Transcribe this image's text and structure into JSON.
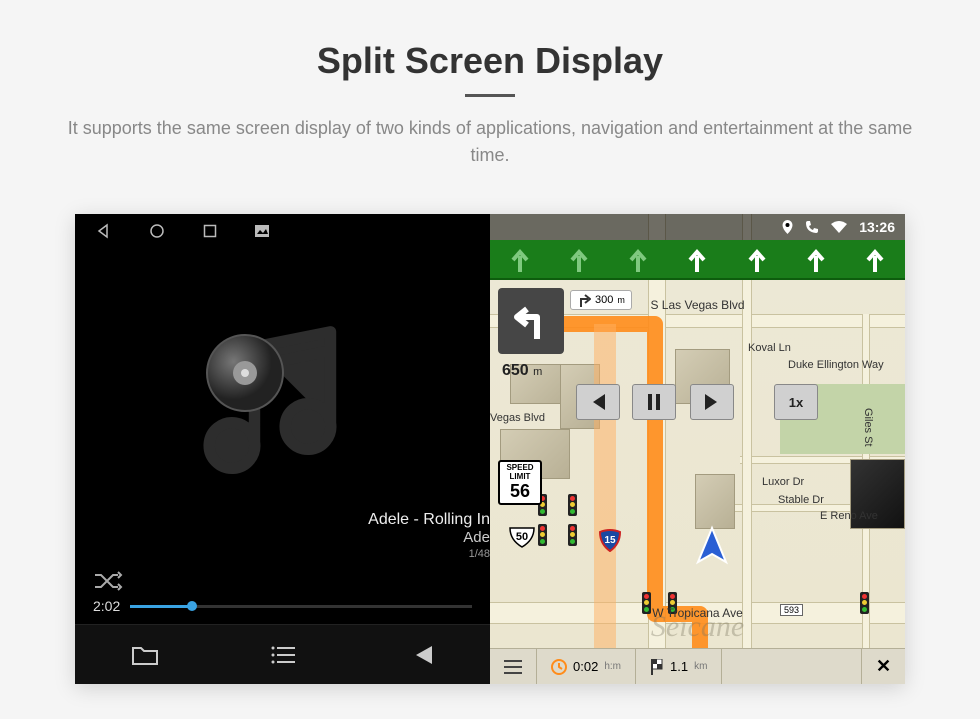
{
  "header": {
    "title": "Split Screen Display",
    "description": "It supports the same screen display of two kinds of applications, navigation and entertainment at the same time."
  },
  "status": {
    "time": "13:26"
  },
  "player": {
    "track_line1": "Adele - Rolling In",
    "track_line2": "Ade",
    "track_count": "1/48",
    "elapsed": "2:02"
  },
  "nav": {
    "next_turn_distance": "300",
    "next_turn_unit": "m",
    "turn_distance": "650",
    "turn_unit": "m",
    "speed_limit_label": "SPEED LIMIT",
    "speed_limit_value": "56",
    "speed_ctrl": "1x",
    "streets": {
      "top": "S Las Vegas Blvd",
      "bottom": "W Tropicana Ave",
      "right1": "Koval Ln",
      "right2": "Duke Ellington Way",
      "right3": "Luxor Dr",
      "right4": "Stable Dr",
      "right5": "E Reno Ave",
      "right6": "Giles St",
      "left1": "Vegas Blvd",
      "exit": "593"
    },
    "shields": {
      "i15": "15",
      "us50": "50"
    },
    "bottom": {
      "time": "0:02",
      "time_unit": "h:m",
      "dist": "1.1",
      "dist_unit": "km"
    },
    "watermark": "Seicane"
  }
}
